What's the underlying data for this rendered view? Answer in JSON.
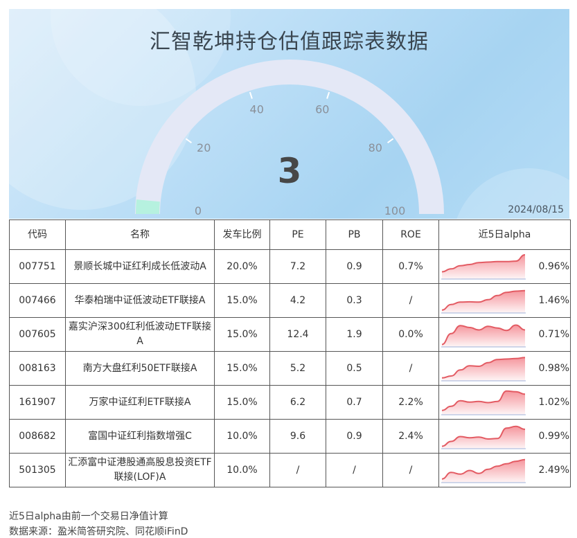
{
  "title": "汇智乾坤持仓估值跟踪表数据",
  "gauge": {
    "value": "3",
    "min": 0,
    "max": 100,
    "ticks": [
      "0",
      "20",
      "40",
      "60",
      "80",
      "100"
    ]
  },
  "date": "2024/08/15",
  "colors": {
    "gauge_track": "#e4e8f6",
    "gauge_fill": "#b6f1df",
    "spark_line": "#e35b63",
    "spark_fill": "#f48a92"
  },
  "table": {
    "headers": [
      "代码",
      "名称",
      "发车比例",
      "PE",
      "PB",
      "ROE",
      "近5日alpha"
    ],
    "rows": [
      {
        "code": "007751",
        "name": "景顺长城中证红利成长低波动A",
        "ratio": "20.0%",
        "pe": "7.2",
        "pb": "0.9",
        "roe": "0.7%",
        "alpha": "0.96%",
        "spark": [
          0.3,
          0.42,
          0.55,
          0.6,
          0.68,
          0.7,
          0.72,
          0.72,
          0.74,
          1.0
        ]
      },
      {
        "code": "007466",
        "name": "华泰柏瑞中证低波动ETF联接A",
        "ratio": "15.0%",
        "pe": "4.2",
        "pb": "0.3",
        "roe": "/",
        "alpha": "1.46%",
        "spark": [
          0.12,
          0.35,
          0.45,
          0.46,
          0.45,
          0.55,
          0.72,
          0.85,
          0.9,
          0.92
        ]
      },
      {
        "code": "007605",
        "name": "嘉实沪深300红利低波动ETF联接A",
        "ratio": "15.0%",
        "pe": "12.4",
        "pb": "1.9",
        "roe": "0.0%",
        "alpha": "0.71%",
        "spark": [
          0.1,
          0.55,
          0.88,
          0.8,
          0.7,
          0.85,
          0.78,
          0.68,
          0.9,
          0.7
        ]
      },
      {
        "code": "008163",
        "name": "南方大盘红利50ETF联接A",
        "ratio": "15.0%",
        "pe": "5.2",
        "pb": "0.5",
        "roe": "/",
        "alpha": "0.98%",
        "spark": [
          0.12,
          0.2,
          0.45,
          0.62,
          0.6,
          0.75,
          0.88,
          0.9,
          0.92,
          0.96
        ]
      },
      {
        "code": "161907",
        "name": "万家中证红利ETF联接A",
        "ratio": "15.0%",
        "pe": "6.2",
        "pb": "0.7",
        "roe": "2.2%",
        "alpha": "1.02%",
        "spark": [
          0.18,
          0.35,
          0.58,
          0.52,
          0.55,
          0.5,
          0.55,
          0.98,
          0.95,
          0.85
        ]
      },
      {
        "code": "008682",
        "name": "富国中证红利指数增强C",
        "ratio": "10.0%",
        "pe": "9.6",
        "pb": "0.9",
        "roe": "2.4%",
        "alpha": "0.99%",
        "spark": [
          0.1,
          0.3,
          0.5,
          0.45,
          0.48,
          0.4,
          0.42,
          0.85,
          0.92,
          0.8
        ]
      },
      {
        "code": "501305",
        "name": "汇添富中证港股通高股息投资ETF联接(LOF)A",
        "ratio": "10.0%",
        "pe": "/",
        "pb": "/",
        "roe": "/",
        "alpha": "2.49%",
        "spark": [
          0.15,
          0.42,
          0.35,
          0.5,
          0.38,
          0.55,
          0.68,
          0.78,
          0.88,
          0.95
        ]
      }
    ]
  },
  "footer": {
    "note": "近5日alpha由前一个交易日净值计算",
    "source": "数据来源：盈米简答研究院、同花顺iFinD"
  }
}
